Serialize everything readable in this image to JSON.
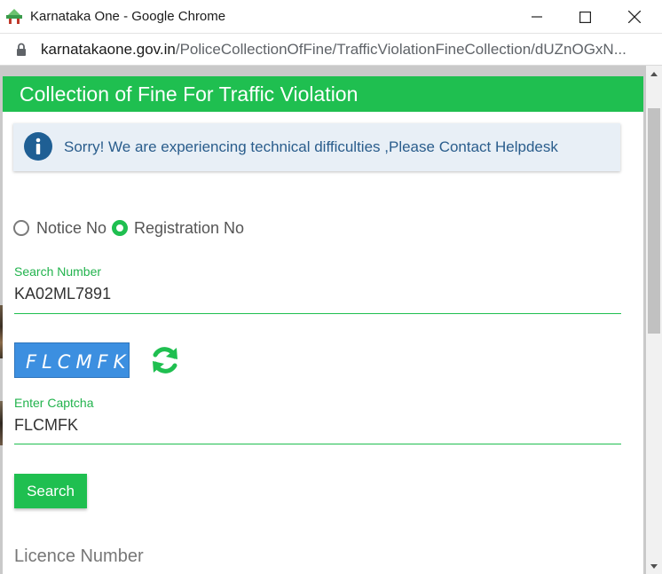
{
  "window": {
    "title": "Karnataka One - Google Chrome"
  },
  "address_bar": {
    "host": "karnatakaone.gov.in",
    "path": "/PoliceCollectionOfFine/TrafficViolationFineCollection/dUZnOGxN..."
  },
  "page": {
    "header_title": "Collection of Fine For Traffic Violation",
    "alert_message": "Sorry! We are experiencing technical difficulties ,Please Contact Helpdesk",
    "radio_options": [
      {
        "label": "Notice No",
        "selected": false
      },
      {
        "label": "Registration No",
        "selected": true
      }
    ],
    "search_number": {
      "label": "Search Number",
      "value": "KA02ML7891"
    },
    "captcha": {
      "image_text": "FLCMFK",
      "label": "Enter Captcha",
      "value": "FLCMFK"
    },
    "search_button": "Search",
    "licence_number_label": "Licence Number"
  },
  "colors": {
    "brand_green": "#1fbf50",
    "alert_bg": "#e8eff6",
    "alert_text": "#2a5d8c",
    "captcha_bg": "#3c8fe0"
  },
  "icons": {
    "app": "karnataka-one-app-icon",
    "lock": "lock-icon",
    "info": "info-icon",
    "refresh": "refresh-captcha-icon"
  }
}
